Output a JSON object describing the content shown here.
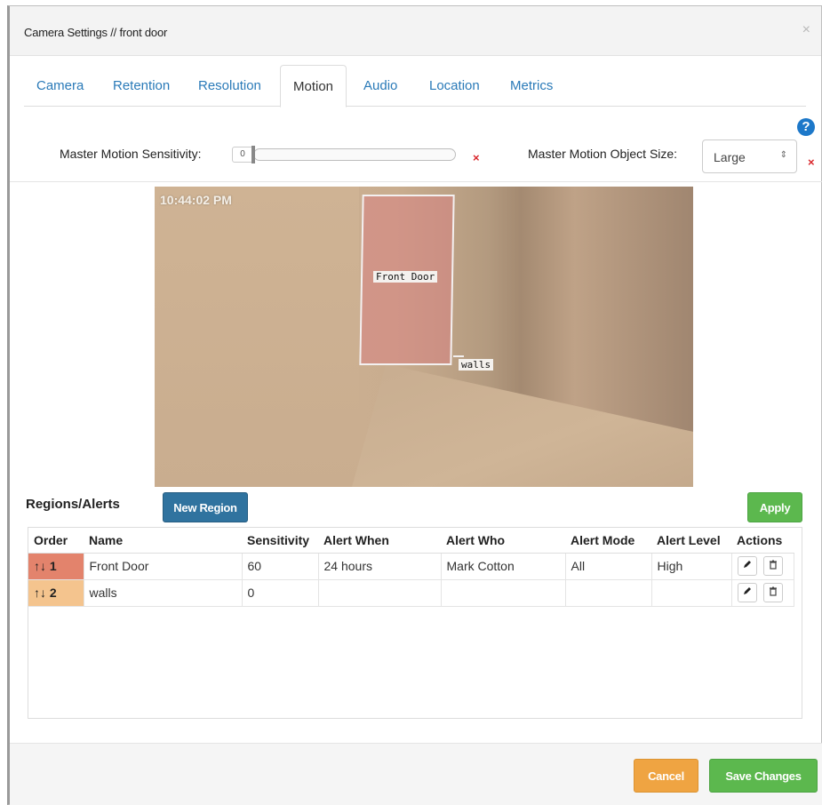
{
  "modal": {
    "title": "Camera Settings // front door",
    "close": "×"
  },
  "tabs": [
    {
      "label": "Camera"
    },
    {
      "label": "Retention"
    },
    {
      "label": "Resolution"
    },
    {
      "label": "Motion",
      "active": true
    },
    {
      "label": "Audio"
    },
    {
      "label": "Location"
    },
    {
      "label": "Metrics"
    }
  ],
  "help": {
    "glyph": "?"
  },
  "motion": {
    "sensitivity_label": "Master Motion Sensitivity:",
    "sensitivity_value": "0",
    "sensitivity_level": 0,
    "clear_x": "×",
    "object_size_label": "Master Motion Object Size:",
    "object_size_value": "Large",
    "select_arrows": "⇕"
  },
  "camera_view": {
    "timestamp": "10:44:02 PM",
    "regions": [
      {
        "label": "Front Door",
        "color": "#d78282"
      },
      {
        "label": "walls"
      }
    ]
  },
  "regions_section": {
    "title": "Regions/Alerts",
    "new_region_label": "New Region",
    "apply_label": "Apply",
    "columns": [
      "Order",
      "Name",
      "Sensitivity",
      "Alert When",
      "Alert Who",
      "Alert Mode",
      "Alert Level",
      "Actions"
    ],
    "rows": [
      {
        "order": "1",
        "name": "Front Door",
        "sensitivity": "60",
        "alert_when": "24 hours",
        "alert_who": "Mark Cotton",
        "alert_mode": "All",
        "alert_level": "High",
        "order_color": "#e3836c"
      },
      {
        "order": "2",
        "name": "walls",
        "sensitivity": "0",
        "alert_when": "",
        "alert_who": "",
        "alert_mode": "",
        "alert_level": "",
        "order_color": "#f4c48e"
      }
    ],
    "arrow_up": "↑",
    "arrow_down": "↓",
    "edit_icon": "pencil-icon",
    "delete_icon": "trash-icon"
  },
  "footer": {
    "cancel_label": "Cancel",
    "save_label": "Save Changes"
  },
  "colors": {
    "link_blue": "#2a7ab8",
    "primary_blue": "#30739f",
    "success_green": "#5cb84e",
    "warning_orange": "#efa442",
    "danger_red": "#d9262b"
  }
}
